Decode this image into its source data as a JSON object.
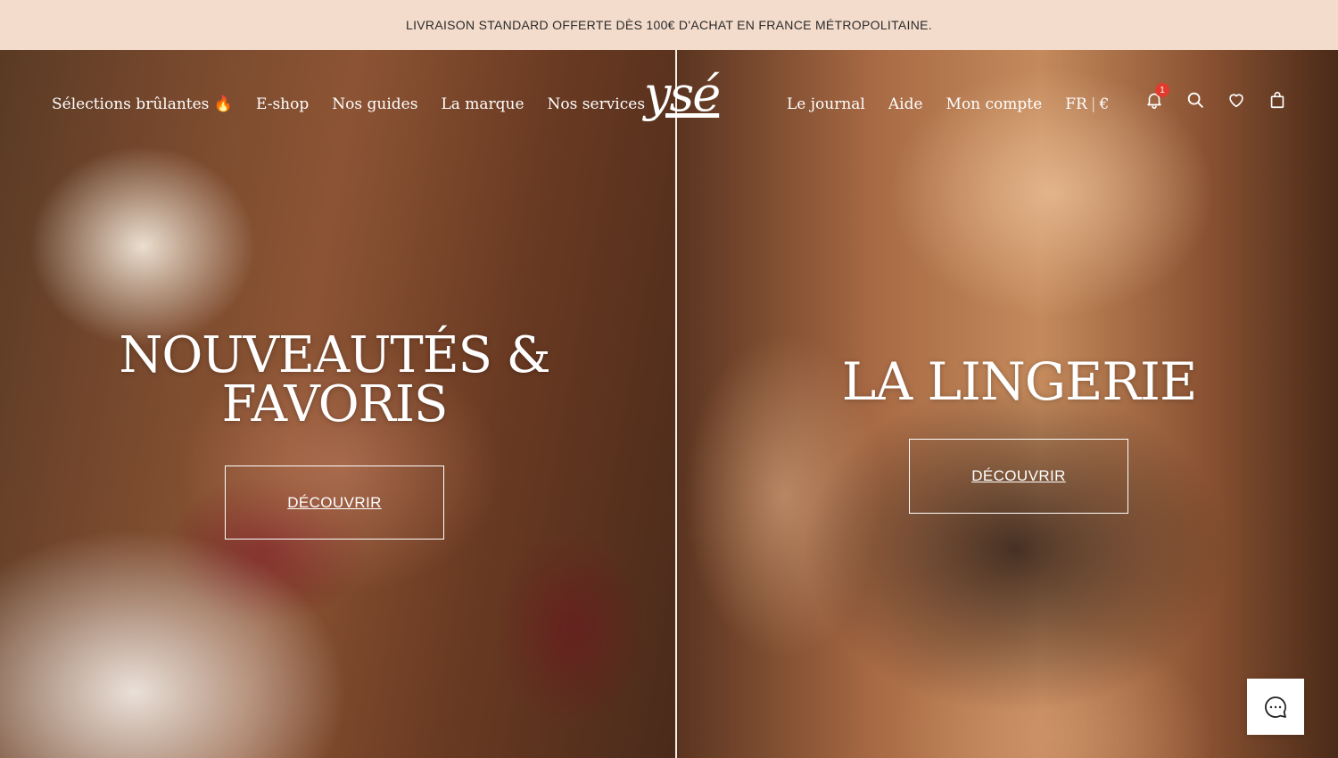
{
  "announcement": {
    "text": "LIVRAISON STANDARD OFFERTE DÈS 100€ D'ACHAT EN FRANCE MÉTROPOLITAINE."
  },
  "brand": {
    "logo_text": "ysé"
  },
  "nav_left": [
    {
      "label": "Sélections brûlantes",
      "emoji": "🔥"
    },
    {
      "label": "E-shop"
    },
    {
      "label": "Nos guides"
    },
    {
      "label": "La marque"
    },
    {
      "label": "Nos services"
    }
  ],
  "nav_right": [
    {
      "label": "Le journal"
    },
    {
      "label": "Aide"
    },
    {
      "label": "Mon compte"
    }
  ],
  "locale": {
    "language": "FR",
    "separator": "|",
    "currency": "€"
  },
  "header_icons": {
    "notifications": {
      "icon": "bell-icon",
      "count": "1"
    },
    "search": {
      "icon": "search-icon"
    },
    "wishlist": {
      "icon": "heart-icon"
    },
    "cart": {
      "icon": "shopping-bag-icon"
    }
  },
  "hero_left": {
    "title_line1": "NOUVEAUTÉS &",
    "title_line2": "FAVORIS",
    "cta": "DÉCOUVRIR"
  },
  "hero_right": {
    "title": "LA LINGERIE",
    "cta": "DÉCOUVRIR"
  },
  "chat": {
    "icon": "chat-bubble-icon"
  },
  "colors": {
    "announcement_bg": "#f3dccc",
    "badge": "#e23b2e",
    "text_light": "#ffffff"
  }
}
